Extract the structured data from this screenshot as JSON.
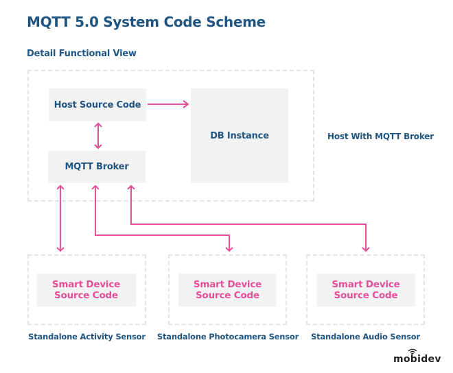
{
  "title": "MQTT 5.0 System Code Scheme",
  "subtitle": "Detail Functional View",
  "host_group": {
    "label": "Host With MQTT Broker",
    "nodes": {
      "host_source": "Host Source Code",
      "mqtt_broker": "MQTT Broker",
      "db_instance": "DB Instance"
    }
  },
  "devices": [
    {
      "line1": "Smart Device",
      "line2": "Source Code",
      "caption": "Standalone Activity Sensor"
    },
    {
      "line1": "Smart Device",
      "line2": "Source Code",
      "caption": "Standalone Photocamera Sensor"
    },
    {
      "line1": "Smart Device",
      "line2": "Source Code",
      "caption": "Standalone Audio Sensor"
    }
  ],
  "connections": [
    {
      "from": "Host Source Code",
      "to": "DB Instance",
      "direction": "one-way"
    },
    {
      "from": "Host Source Code",
      "to": "MQTT Broker",
      "direction": "two-way"
    },
    {
      "from": "MQTT Broker",
      "to": "Standalone Activity Sensor",
      "direction": "two-way"
    },
    {
      "from": "MQTT Broker",
      "to": "Standalone Photocamera Sensor",
      "direction": "two-way"
    },
    {
      "from": "MQTT Broker",
      "to": "Standalone Audio Sensor",
      "direction": "two-way"
    }
  ],
  "colors": {
    "heading": "#1f5583",
    "accent": "#e54e98",
    "box_fill": "#f2f2f2",
    "dash": "#e3e3e3"
  },
  "logo": "mobidev"
}
